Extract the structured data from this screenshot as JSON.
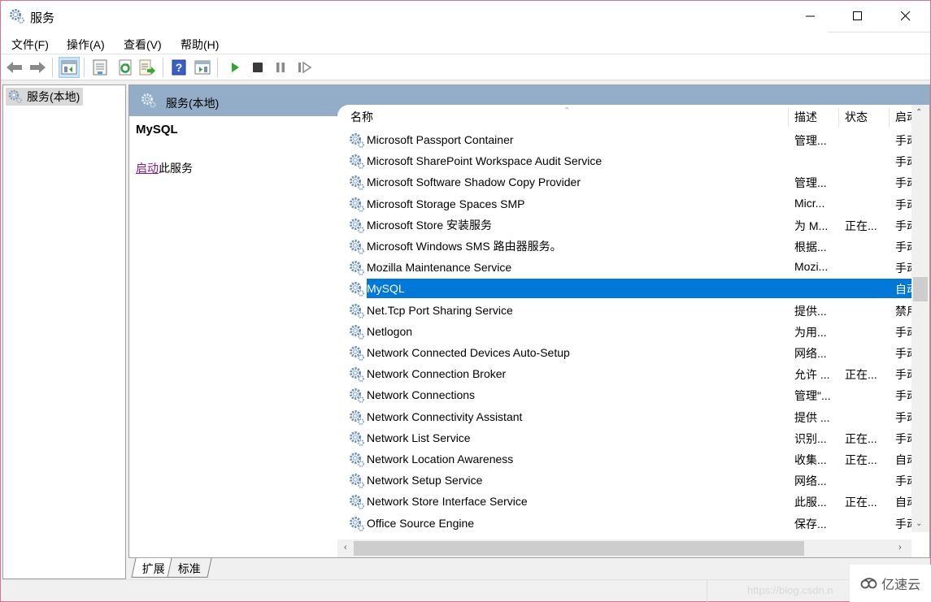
{
  "window": {
    "title": "服务",
    "controls": {
      "minimize": "minimize",
      "maximize": "maximize",
      "close": "close"
    }
  },
  "menu": [
    {
      "label": "文件(F)"
    },
    {
      "label": "操作(A)"
    },
    {
      "label": "查看(V)"
    },
    {
      "label": "帮助(H)"
    }
  ],
  "toolbar": {
    "buttons": [
      {
        "icon": "back-arrow-icon",
        "label": "后退"
      },
      {
        "icon": "forward-arrow-icon",
        "label": "前进"
      },
      {
        "icon": "show-hide-console-tree-icon",
        "label": "显示/隐藏控制台树",
        "active": true
      },
      {
        "icon": "properties-icon",
        "label": "属性"
      },
      {
        "icon": "refresh-icon",
        "label": "刷新"
      },
      {
        "icon": "export-list-icon",
        "label": "导出列表"
      },
      {
        "icon": "help-icon",
        "label": "帮助"
      },
      {
        "icon": "show-action-pane-icon",
        "label": "显示操作窗格"
      },
      {
        "icon": "start-service-icon",
        "label": "启动服务"
      },
      {
        "icon": "stop-service-icon",
        "label": "停止服务"
      },
      {
        "icon": "pause-service-icon",
        "label": "暂停服务"
      },
      {
        "icon": "resume-service-icon",
        "label": "重新启动服务"
      }
    ]
  },
  "tree": {
    "root": "服务(本地)"
  },
  "pane": {
    "header": "服务(本地)",
    "selected_service": "MySQL",
    "action_link": "启动",
    "action_suffix": "此服务"
  },
  "list": {
    "columns": [
      {
        "label": "名称",
        "sorted": "ascending"
      },
      {
        "label": "描述"
      },
      {
        "label": "状态"
      },
      {
        "label": "启动"
      }
    ],
    "rows": [
      {
        "name": "Microsoft Passport Container",
        "description": "管理...",
        "status": "",
        "startup": "手动"
      },
      {
        "name": "Microsoft SharePoint Workspace Audit Service",
        "description": "",
        "status": "",
        "startup": "手动"
      },
      {
        "name": "Microsoft Software Shadow Copy Provider",
        "description": "管理...",
        "status": "",
        "startup": "手动"
      },
      {
        "name": "Microsoft Storage Spaces SMP",
        "description": "Micr...",
        "status": "",
        "startup": "手动"
      },
      {
        "name": "Microsoft Store 安装服务",
        "description": "为 M...",
        "status": "正在...",
        "startup": "手动"
      },
      {
        "name": "Microsoft Windows SMS 路由器服务。",
        "description": "根据...",
        "status": "",
        "startup": "手动"
      },
      {
        "name": "Mozilla Maintenance Service",
        "description": "Mozi...",
        "status": "",
        "startup": "手动"
      },
      {
        "name": "MySQL",
        "description": "",
        "status": "",
        "startup": "自动",
        "selected": true
      },
      {
        "name": "Net.Tcp Port Sharing Service",
        "description": "提供...",
        "status": "",
        "startup": "禁用"
      },
      {
        "name": "Netlogon",
        "description": "为用...",
        "status": "",
        "startup": "手动"
      },
      {
        "name": "Network Connected Devices Auto-Setup",
        "description": "网络...",
        "status": "",
        "startup": "手动"
      },
      {
        "name": "Network Connection Broker",
        "description": "允许 ...",
        "status": "正在...",
        "startup": "手动"
      },
      {
        "name": "Network Connections",
        "description": "管理\"...",
        "status": "",
        "startup": "手动"
      },
      {
        "name": "Network Connectivity Assistant",
        "description": "提供 ...",
        "status": "",
        "startup": "手动"
      },
      {
        "name": "Network List Service",
        "description": "识别...",
        "status": "正在...",
        "startup": "手动"
      },
      {
        "name": "Network Location Awareness",
        "description": "收集...",
        "status": "正在...",
        "startup": "自动"
      },
      {
        "name": "Network Setup Service",
        "description": "网络...",
        "status": "",
        "startup": "手动"
      },
      {
        "name": "Network Store Interface Service",
        "description": "此服...",
        "status": "正在...",
        "startup": "自动"
      },
      {
        "name": "Office  Source Engine",
        "description": "保存...",
        "status": "",
        "startup": "手动"
      }
    ]
  },
  "tabs": [
    {
      "label": "扩展",
      "active": true
    },
    {
      "label": "标准",
      "active": false
    }
  ],
  "statusbar": {
    "watermark": "https://blog.csdn.n"
  },
  "overlay_logo": {
    "text": "亿速云"
  },
  "colors": {
    "selection": "#0078d7",
    "pane_header": "#93adc8",
    "link": "#8b1a8b",
    "window_border": "#d8738f"
  }
}
